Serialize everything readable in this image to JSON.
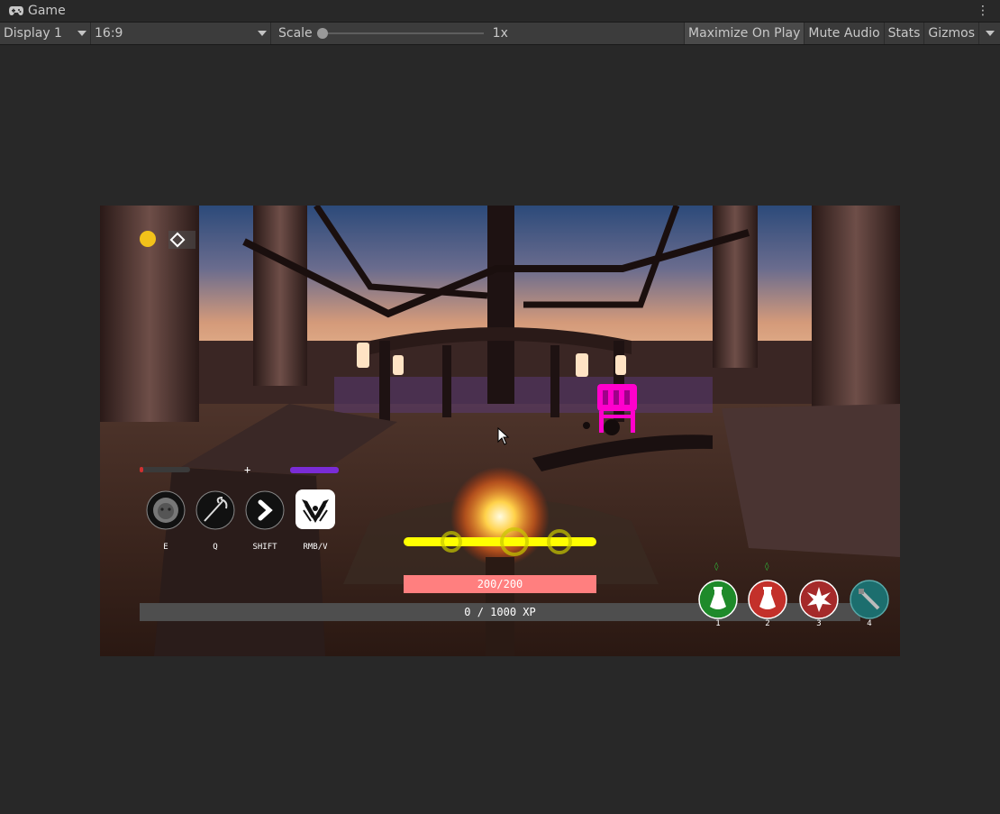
{
  "window": {
    "tab_title": "Game",
    "menu_icon": "kebab-menu-icon"
  },
  "toolbar": {
    "display": "Display 1",
    "aspect": "16:9",
    "scale_label": "Scale",
    "scale_value": "1x",
    "scale_slider": 0,
    "maximize_on_play": "Maximize On Play",
    "mute_audio": "Mute Audio",
    "stats": "Stats",
    "gizmos": "Gizmos"
  },
  "hud": {
    "abilities": [
      {
        "icon": "lion-icon",
        "key": "E"
      },
      {
        "icon": "grappling-hook-icon",
        "key": "Q"
      },
      {
        "icon": "chevron-right-icon",
        "key": "SHIFT"
      },
      {
        "icon": "wings-icon",
        "key": "RMB/V"
      }
    ],
    "crosshair": "+",
    "health_text": "200/200",
    "xp_text": "0 / 1000 XP",
    "xp_fill": 0,
    "ability_meters": {
      "left": 0.08,
      "right": 1.0
    },
    "items": [
      {
        "icon": "green-potion-icon",
        "key": "1",
        "color": "#1e8a2a"
      },
      {
        "icon": "red-potion-icon",
        "key": "2",
        "color": "#c3302a"
      },
      {
        "icon": "burst-icon",
        "key": "3",
        "color": "#a52a2a"
      },
      {
        "icon": "blade-icon",
        "key": "4",
        "color": "#1c6e6e"
      }
    ],
    "colors": {
      "health": "#ff7f7f",
      "enemy_bar": "#ffff00",
      "mana": "#7a2cd6",
      "enemy_marker": "#ff00cc"
    }
  }
}
